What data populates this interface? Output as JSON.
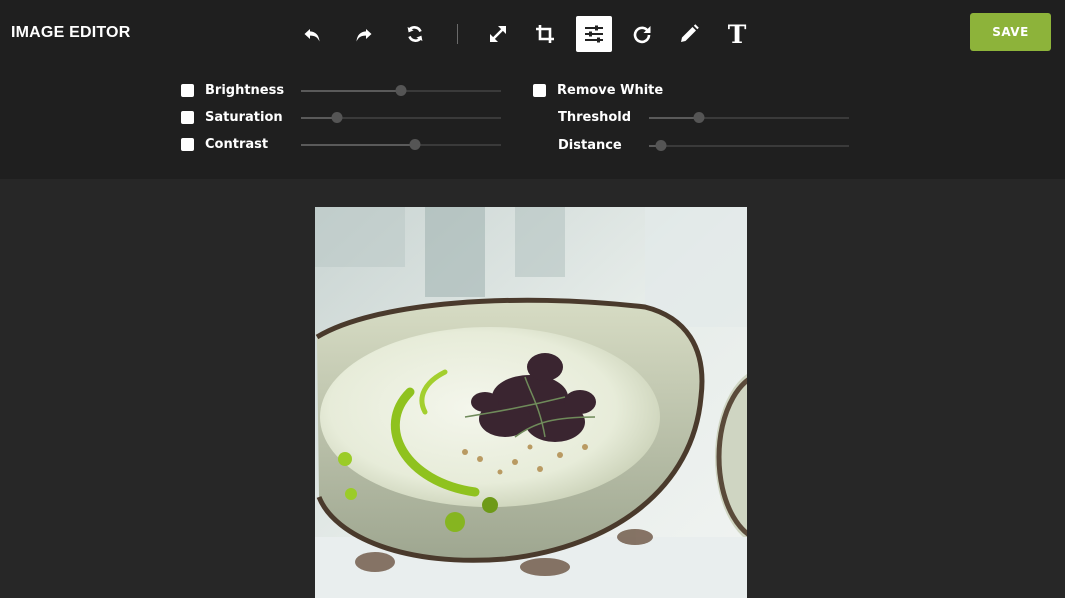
{
  "app": {
    "title": "IMAGE EDITOR"
  },
  "toolbar": {
    "tools": [
      {
        "name": "undo",
        "icon": "undo-icon"
      },
      {
        "name": "redo",
        "icon": "redo-icon"
      },
      {
        "name": "reset",
        "icon": "reset-icon"
      },
      {
        "name": "resize",
        "icon": "resize-icon"
      },
      {
        "name": "crop",
        "icon": "crop-icon"
      },
      {
        "name": "adjust",
        "icon": "sliders-icon",
        "active": true
      },
      {
        "name": "rotate",
        "icon": "rotate-icon"
      },
      {
        "name": "draw",
        "icon": "pencil-icon"
      },
      {
        "name": "text",
        "icon": "text-icon",
        "glyph": "T"
      }
    ],
    "save_label": "SAVE"
  },
  "adjustments": {
    "brightness": {
      "label": "Brightness",
      "checked": false,
      "value": 0.5
    },
    "saturation": {
      "label": "Saturation",
      "checked": false,
      "value": 0.18
    },
    "contrast": {
      "label": "Contrast",
      "checked": false,
      "value": 0.57
    },
    "remove_white": {
      "label": "Remove White",
      "checked": false
    },
    "threshold": {
      "label": "Threshold",
      "value": 0.25
    },
    "distance": {
      "label": "Distance",
      "value": 0.06
    }
  },
  "colors": {
    "accent": "#8db33a",
    "toolbar_bg": "#1f1f1f",
    "workspace_bg": "#272727"
  }
}
